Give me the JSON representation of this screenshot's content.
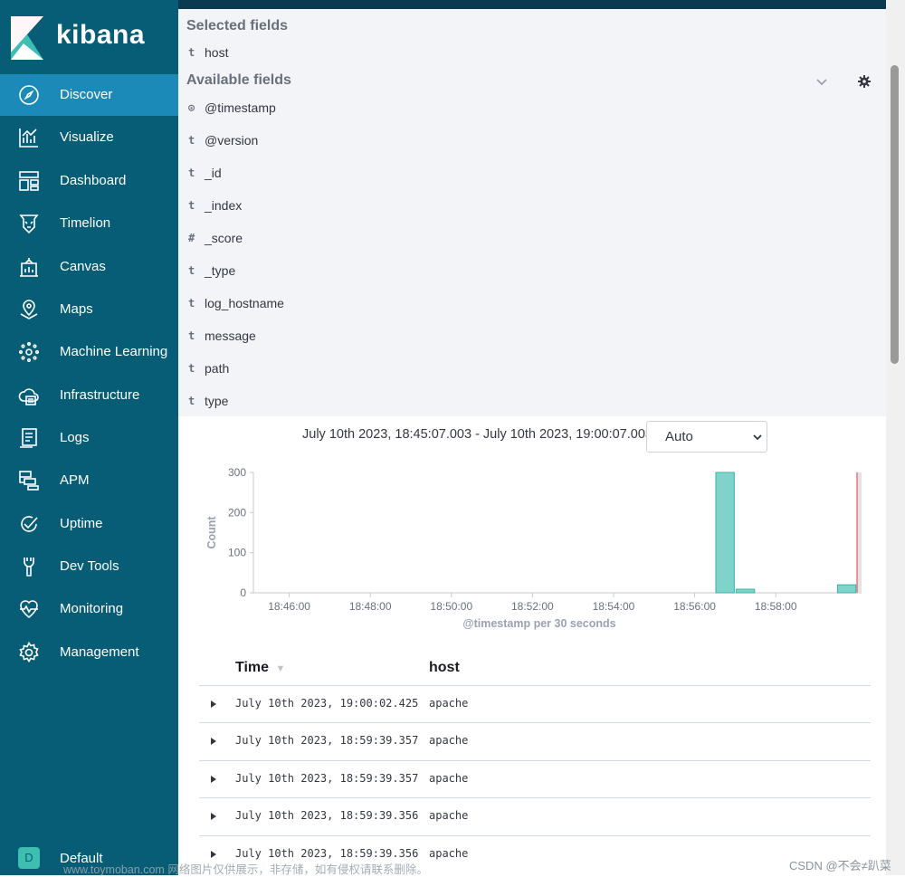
{
  "app": {
    "logo_text": "kibana"
  },
  "sidebar": {
    "items": [
      {
        "label": "Discover",
        "icon": "compass-icon",
        "active": true
      },
      {
        "label": "Visualize",
        "icon": "visualize-icon"
      },
      {
        "label": "Dashboard",
        "icon": "dashboard-icon"
      },
      {
        "label": "Timelion",
        "icon": "timelion-icon"
      },
      {
        "label": "Canvas",
        "icon": "canvas-icon"
      },
      {
        "label": "Maps",
        "icon": "maps-icon"
      },
      {
        "label": "Machine Learning",
        "icon": "machine-learning-icon"
      },
      {
        "label": "Infrastructure",
        "icon": "infrastructure-icon"
      },
      {
        "label": "Logs",
        "icon": "logs-icon"
      },
      {
        "label": "APM",
        "icon": "apm-icon"
      },
      {
        "label": "Uptime",
        "icon": "uptime-icon"
      },
      {
        "label": "Dev Tools",
        "icon": "dev-tools-icon"
      },
      {
        "label": "Monitoring",
        "icon": "monitoring-icon"
      },
      {
        "label": "Management",
        "icon": "gear-icon"
      }
    ],
    "space": {
      "avatar": "D",
      "label": "Default"
    }
  },
  "fields": {
    "selected_title": "Selected fields",
    "selected": [
      {
        "type": "t",
        "name": "host"
      }
    ],
    "available_title": "Available fields",
    "available": [
      {
        "type": "⊙",
        "name": "@timestamp"
      },
      {
        "type": "t",
        "name": "@version"
      },
      {
        "type": "t",
        "name": "_id"
      },
      {
        "type": "t",
        "name": "_index"
      },
      {
        "type": "#",
        "name": "_score"
      },
      {
        "type": "t",
        "name": "_type"
      },
      {
        "type": "t",
        "name": "log_hostname"
      },
      {
        "type": "t",
        "name": "message"
      },
      {
        "type": "t",
        "name": "path"
      },
      {
        "type": "t",
        "name": "type"
      }
    ]
  },
  "histogram": {
    "time_range": "July 10th 2023, 18:45:07.003 - July 10th 2023, 19:00:07.003 —",
    "interval": "Auto"
  },
  "chart_data": {
    "type": "bar",
    "ylabel": "Count",
    "xlabel": "@timestamp per 30 seconds",
    "ylim": [
      0,
      300
    ],
    "yticks": [
      0,
      100,
      200,
      300
    ],
    "xticks": [
      "18:46:00",
      "18:48:00",
      "18:50:00",
      "18:52:00",
      "18:54:00",
      "18:56:00",
      "18:58:00"
    ],
    "bars": [
      {
        "x": "18:56:30",
        "value": 300
      },
      {
        "x": "18:57:00",
        "value": 9
      },
      {
        "x": "18:59:30",
        "value": 20
      }
    ],
    "bar_color": "#7fd3cb"
  },
  "table": {
    "columns": [
      "Time",
      "host"
    ],
    "rows": [
      {
        "time": "July 10th 2023, 19:00:02.425",
        "host": "apache"
      },
      {
        "time": "July 10th 2023, 18:59:39.357",
        "host": "apache"
      },
      {
        "time": "July 10th 2023, 18:59:39.357",
        "host": "apache"
      },
      {
        "time": "July 10th 2023, 18:59:39.356",
        "host": "apache"
      },
      {
        "time": "July 10th 2023, 18:59:39.356",
        "host": "apache"
      }
    ]
  },
  "watermarks": {
    "left": "www.toymoban.com 网络图片仅供展示，非存储，如有侵权请联系删除。",
    "right": "CSDN @不会≠趴菜"
  }
}
